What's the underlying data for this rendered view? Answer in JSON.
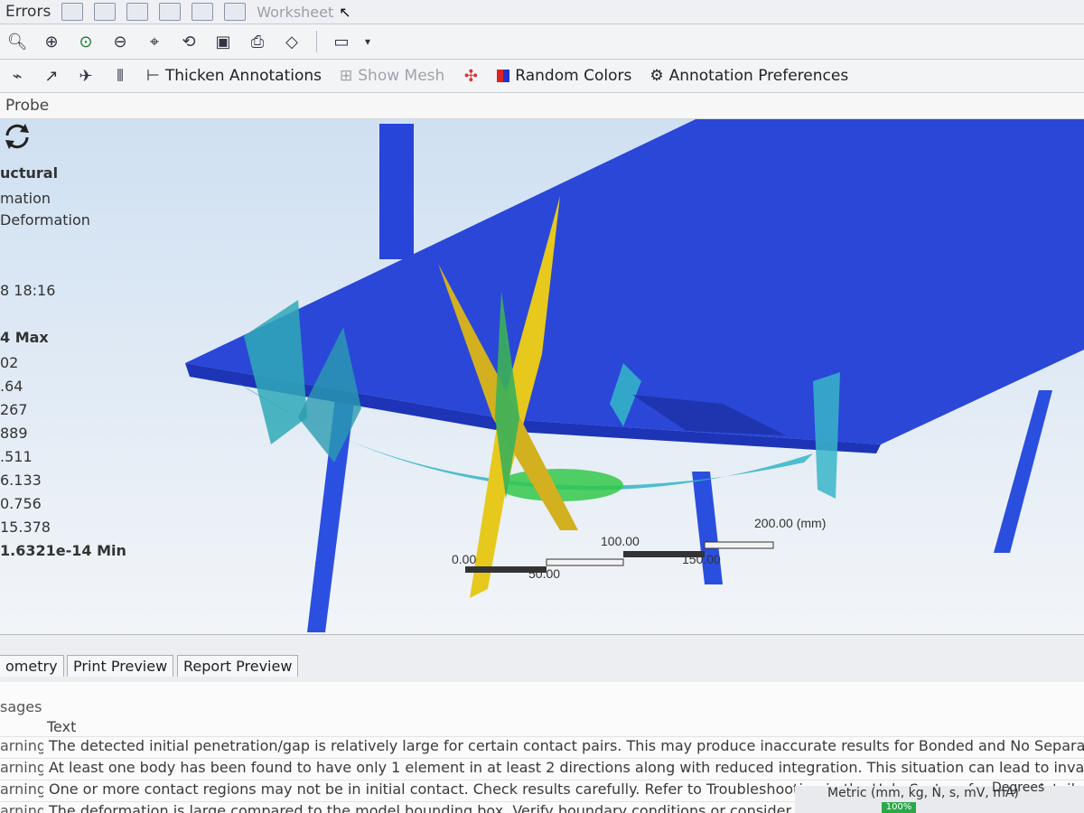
{
  "menubar": {
    "errors_label": "Errors",
    "worksheet_label": "Worksheet"
  },
  "toolbar2": {
    "thicken_label": "Thicken Annotations",
    "show_mesh_label": "Show Mesh",
    "random_colors_label": "Random Colors",
    "annotation_prefs_label": "Annotation Preferences"
  },
  "probe": {
    "label": "Probe"
  },
  "legend": {
    "lines": [
      "uctural",
      "mation",
      "Deformation",
      "8 18:16",
      "4 Max",
      "02",
      ".64",
      "267",
      "889",
      ".511",
      "6.133",
      "0.756",
      "15.378",
      "1.6321e-14 Min"
    ]
  },
  "scale": {
    "t0": "0.00",
    "t50": "50.00",
    "t100": "100.00",
    "t150": "150.00",
    "t200": "200.00 (mm)"
  },
  "tabs": {
    "geometry": "ometry",
    "print_preview": "Print Preview",
    "report_preview": "Report Preview"
  },
  "messages": {
    "header": "sages",
    "column_text": "Text",
    "rows": [
      {
        "type": "arning",
        "text": "The detected initial penetration/gap is relatively large for certain contact pairs. This may produce inaccurate results for Bonded and No Separation contacts using formulatio"
      },
      {
        "type": "arning",
        "text": "At least one body has been found to have only 1 element in at least 2 directions along with reduced integration. This situation can lead to invalid results. Consider changing"
      },
      {
        "type": "arning",
        "text": "One or more contact regions may not be in initial contact. Check results carefully. Refer to Troubleshooting in the Help System for more details."
      },
      {
        "type": "arning",
        "text": "The deformation is large compared to the model bounding box. Verify boundary conditions or consider turning large deflection on. Refer to Troubleshooting in the Help S"
      }
    ]
  },
  "status": {
    "units": "Metric (mm, kg, N, s, mV, mA)",
    "angle": "Degrees",
    "battery": "100%"
  },
  "colors": {
    "model": "#1f3fd6",
    "viewport_top": "#cfe0f2",
    "accent_yellow": "#e6c91c",
    "accent_green": "#38c24a"
  }
}
